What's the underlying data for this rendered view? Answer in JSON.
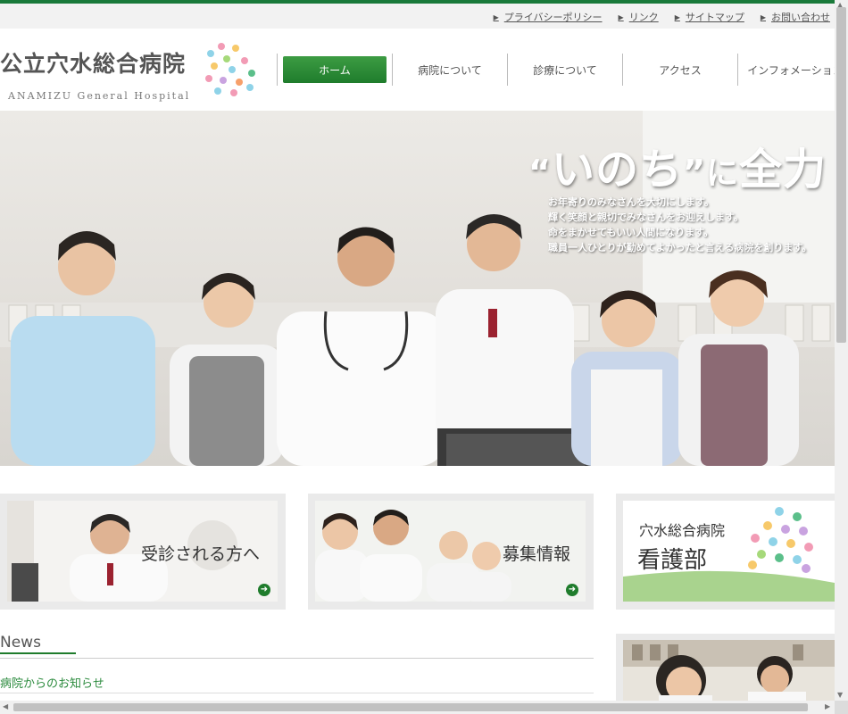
{
  "utility_links": [
    {
      "label": "プライバシーポリシー"
    },
    {
      "label": "リンク"
    },
    {
      "label": "サイトマップ"
    },
    {
      "label": "お問い合わせ"
    }
  ],
  "logo": {
    "name_jp": "公立穴水総合病院",
    "name_en": "ANAMIZU General Hospital"
  },
  "nav": [
    {
      "label": "ホーム",
      "active": true
    },
    {
      "label": "病院について"
    },
    {
      "label": "診療について"
    },
    {
      "label": "アクセス"
    },
    {
      "label": "インフォメーション"
    }
  ],
  "hero": {
    "title_open": "“",
    "title_main": "いのち",
    "title_close": "”",
    "title_ni": "に",
    "title_end": "全力",
    "lines": [
      "お年寄りのみなさんを大切にします。",
      "輝く笑顔と親切でみなさんをお迎えします。",
      "命をまかせてもいい人間になります。",
      "職員一人ひとりが勤めてよかったと言える病院を創ります。"
    ]
  },
  "banners": [
    {
      "label": "受診される方へ"
    },
    {
      "label": "募集情報"
    },
    {
      "line1": "穴水総合病院",
      "line2": "看護部"
    }
  ],
  "news": {
    "title": "News",
    "subtitle": "病院からのお知らせ"
  },
  "colors": {
    "brand_green": "#1f7c2c",
    "link_green": "#2a8a3c"
  }
}
